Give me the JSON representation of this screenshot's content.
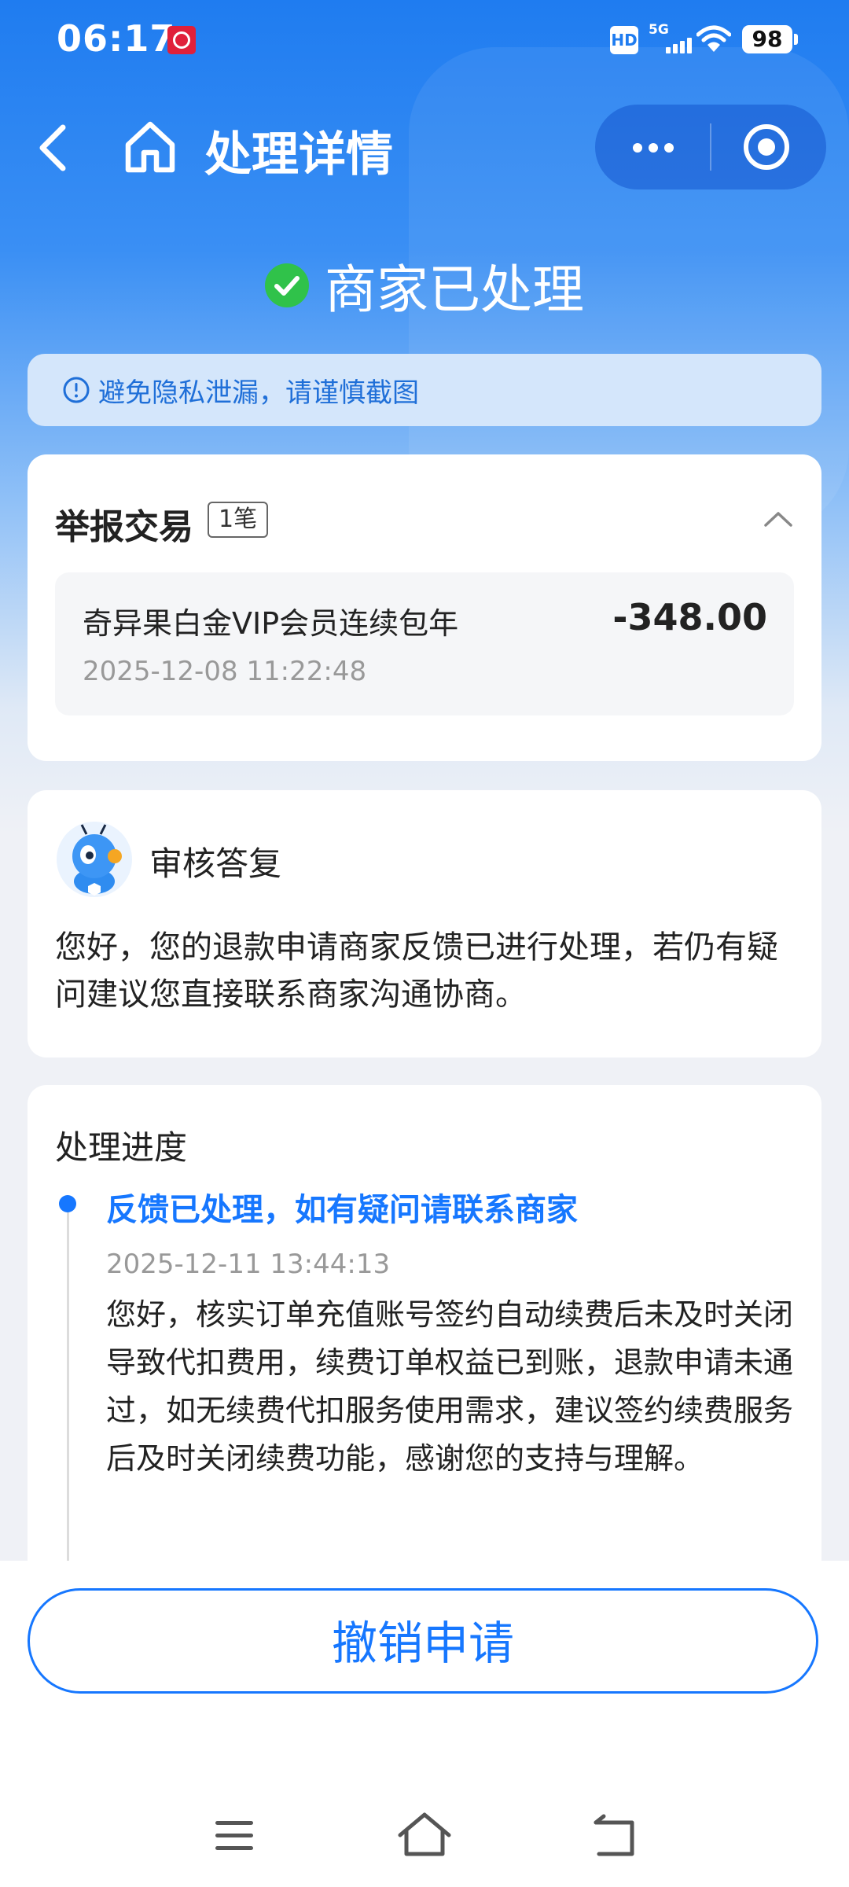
{
  "status_bar": {
    "time": "06:17",
    "hd": "HD",
    "network": "5G",
    "battery": "98"
  },
  "nav": {
    "title": "处理详情",
    "back_icon": "chevron-left-icon",
    "home_icon": "home-icon",
    "more_icon": "more-dots-icon",
    "close_icon": "target-close-icon"
  },
  "status": {
    "icon": "check-circle-icon",
    "text": "商家已处理",
    "icon_color": "#30c24a"
  },
  "notice": {
    "icon": "info-circle-icon",
    "text": "避免隐私泄漏，请谨慎截图"
  },
  "report": {
    "title": "举报交易",
    "count": "1笔",
    "collapse_icon": "chevron-up-icon",
    "transaction": {
      "name": "奇异果白金VIP会员连续包年",
      "amount": "-348.00",
      "time": "2025-12-08 11:22:48"
    }
  },
  "reply": {
    "avatar": "robot-avatar-icon",
    "title": "审核答复",
    "body": "您好，您的退款申请商家反馈已进行处理，若仍有疑问建议您直接联系商家沟通协商。"
  },
  "progress": {
    "title": "处理进度",
    "steps": [
      {
        "title": "反馈已处理，如有疑问请联系商家",
        "time": "2025-12-11 13:44:13",
        "body": "您好，核实订单充值账号签约自动续费后未及时关闭导致代扣费用，续费订单权益已到账，退款申请未通过，如无续费代扣服务使用需求，建议签约续费服务后及时关闭续费功能，感谢您的支持与理解。"
      }
    ]
  },
  "actions": {
    "cancel_label": "撤销申请"
  },
  "colors": {
    "accent": "#1677ff",
    "header_blue": "#1f7cf0",
    "success": "#30c24a"
  },
  "system_nav": {
    "menu_icon": "menu-icon",
    "home_icon": "home-outline-icon",
    "back_icon": "back-arrow-icon"
  }
}
